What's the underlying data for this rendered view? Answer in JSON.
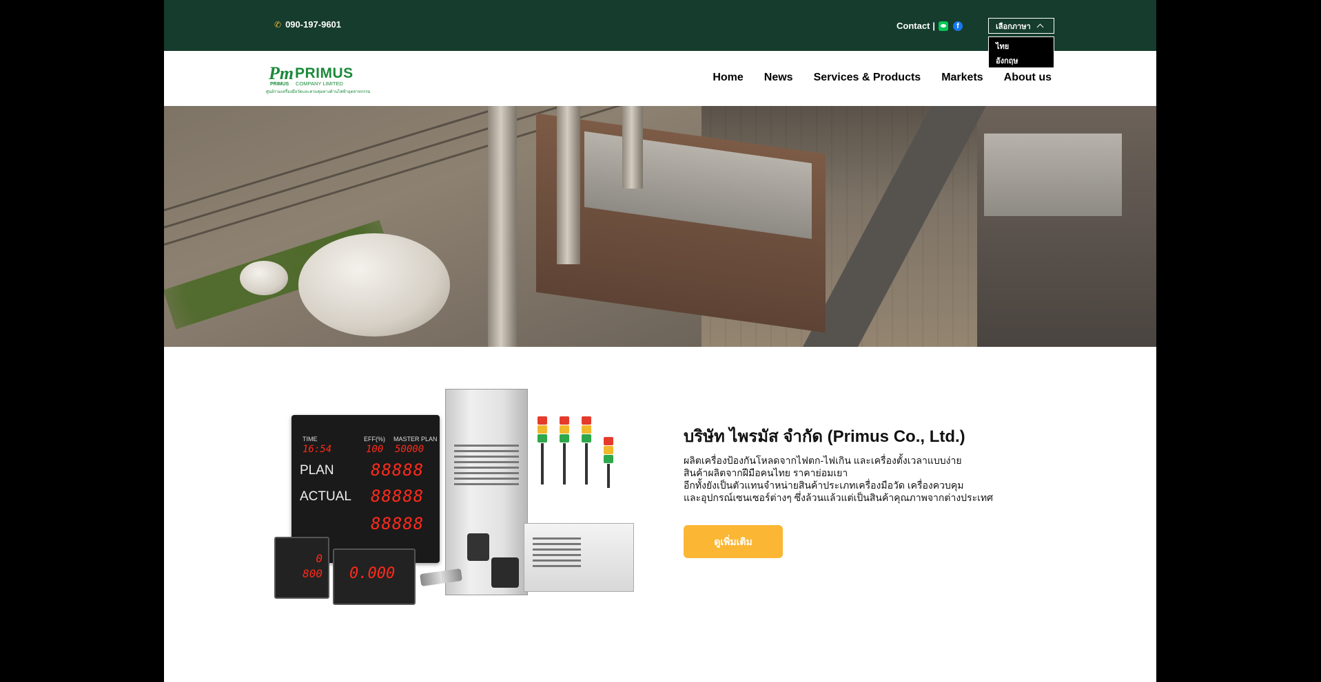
{
  "topbar": {
    "phone": "090-197-9601",
    "contact_label": "Contact",
    "separator": "|",
    "social_icons": [
      "line-icon",
      "facebook-icon"
    ],
    "language": {
      "selected_label": "เลือกภาษา",
      "options": [
        "ไทย",
        "อังกฤษ"
      ]
    }
  },
  "header": {
    "logo": {
      "mark": "Pm",
      "mark_small": "PRIMUS",
      "name": "PRIMUS",
      "subtitle": "COMPANY LIMITED",
      "tagline": "ศูนย์รวมเครื่องมือวัดและควบคุมทางด้านไฟฟ้าอุตสาหกรรม"
    },
    "nav": [
      "Home",
      "News",
      "Services & Products",
      "Markets",
      "About us"
    ]
  },
  "product_image": {
    "board_headers": [
      "TIME",
      "EFF(%)",
      "MASTER PLAN"
    ],
    "board_top_values": [
      "16:54",
      "100",
      "50000"
    ],
    "board_rows": [
      {
        "label": "PLAN",
        "digits": "88888"
      },
      {
        "label": "ACTUAL",
        "digits": "88888"
      },
      {
        "label": "",
        "digits": "88888"
      }
    ],
    "meter1_values": [
      "0",
      "800"
    ],
    "meter2_value": "0.000"
  },
  "about": {
    "title": "บริษัท ไพรมัส จำกัด (Primus Co., Ltd.)",
    "lines": [
      "ผลิตเครื่องป้องกันโหลดจากไฟตก-ไฟเกิน และเครื่องตั้งเวลาแบบง่าย",
      "สินค้าผลิตจากฝีมือคนไทย ราคาย่อมเยา",
      "อีกทั้งยังเป็นตัวแทนจำหน่ายสินค้าประเภทเครื่องมือวัด เครื่องควบคุม",
      "และอุปกรณ์เซนเซอร์ต่างๆ ซึ่งล้วนแล้วแต่เป็นสินค้าคุณภาพจากต่างประเทศ"
    ],
    "button_label": "ดูเพิ่มเติม"
  },
  "colors": {
    "topbar": "#153c2d",
    "accent": "#fbb634",
    "brand_green": "#1b8a3a"
  }
}
